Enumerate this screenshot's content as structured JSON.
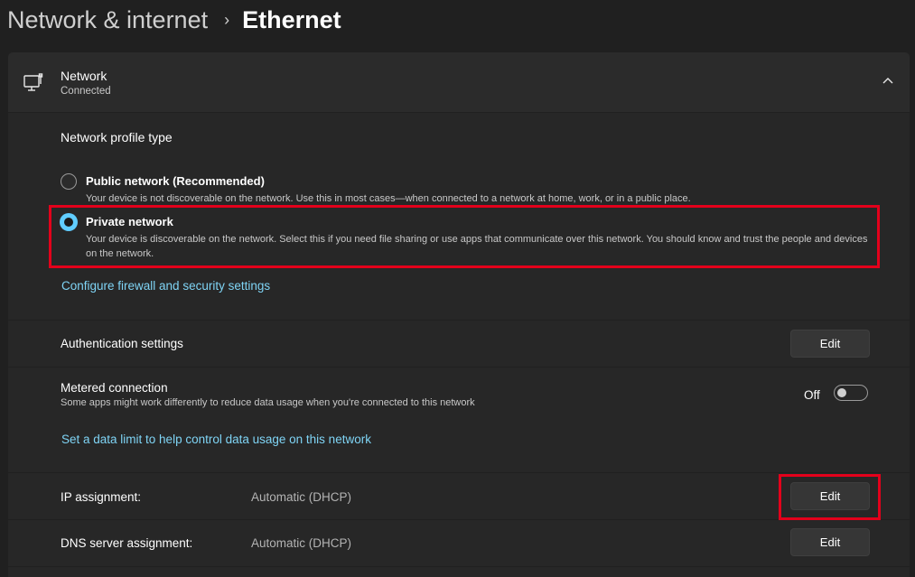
{
  "breadcrumb": {
    "parent": "Network & internet",
    "separator": "›",
    "current": "Ethernet"
  },
  "network": {
    "title": "Network",
    "status": "Connected",
    "icon": "ethernet-monitor-icon",
    "expand_icon": "chevron-up-icon"
  },
  "profile": {
    "title": "Network profile type",
    "options": [
      {
        "label": "Public network (Recommended)",
        "description": "Your device is not discoverable on the network. Use this in most cases—when connected to a network at home, work, or in a public place.",
        "selected": false
      },
      {
        "label": "Private network",
        "description": "Your device is discoverable on the network. Select this if you need file sharing or use apps that communicate over this network. You should know and trust the people and devices on the network.",
        "selected": true
      }
    ],
    "firewall_link": "Configure firewall and security settings"
  },
  "auth": {
    "label": "Authentication settings",
    "button": "Edit"
  },
  "metered": {
    "label": "Metered connection",
    "description": "Some apps might work differently to reduce data usage when you're connected to this network",
    "toggle_state": "Off",
    "data_limit_link": "Set a data limit to help control data usage on this network"
  },
  "ip": {
    "label": "IP assignment:",
    "value": "Automatic (DHCP)",
    "button": "Edit"
  },
  "dns": {
    "label": "DNS server assignment:",
    "value": "Automatic (DHCP)",
    "button": "Edit"
  },
  "colors": {
    "accent": "#60cdff",
    "link": "#7fd4f5",
    "highlight": "#e3001b",
    "background": "#202020"
  }
}
